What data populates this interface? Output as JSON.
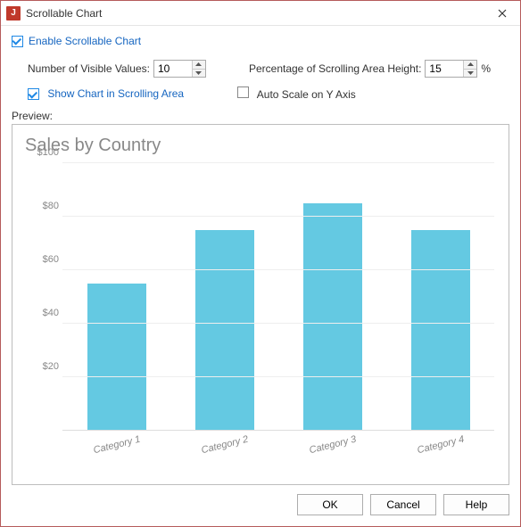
{
  "window": {
    "title": "Scrollable Chart",
    "icon_letter": "J"
  },
  "enable": {
    "label": "Enable Scrollable Chart",
    "checked": true
  },
  "visible_values": {
    "label": "Number of Visible Values:",
    "value": "10"
  },
  "scroll_height": {
    "label": "Percentage of Scrolling Area Height:",
    "value": "15",
    "suffix": "%"
  },
  "show_in_area": {
    "label": "Show Chart in Scrolling Area",
    "checked": true
  },
  "auto_scale": {
    "label": "Auto Scale on Y Axis",
    "checked": false
  },
  "preview_label": "Preview:",
  "buttons": {
    "ok": "OK",
    "cancel": "Cancel",
    "help": "Help"
  },
  "chart_data": {
    "type": "bar",
    "title": "Sales by Country",
    "ylabel": "",
    "xlabel": "",
    "ylim": [
      0,
      100
    ],
    "yticks": [
      20,
      40,
      60,
      80,
      100
    ],
    "ytick_prefix": "$",
    "categories": [
      "Category 1",
      "Category 2",
      "Category 3",
      "Category 4"
    ],
    "values": [
      55,
      75,
      85,
      75
    ],
    "bar_color": "#64c9e2"
  }
}
